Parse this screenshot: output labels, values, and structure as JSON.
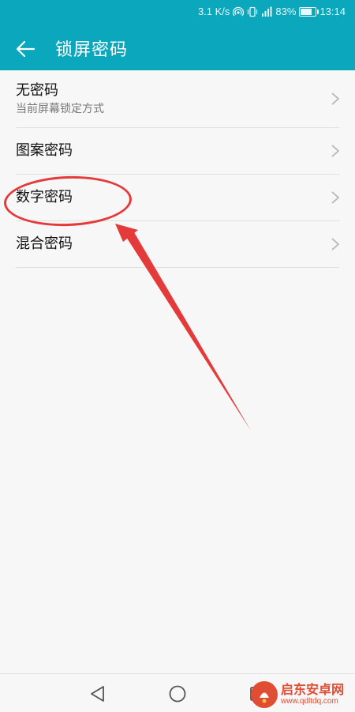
{
  "status_bar": {
    "speed": "3.1 K/s",
    "battery": "83%",
    "battery_level": 0.83,
    "time": "13:14",
    "icons": [
      "hotspot-icon",
      "vibrate-icon",
      "signal-4g-icon",
      "battery-icon"
    ]
  },
  "header": {
    "back_icon": "back-arrow-icon",
    "title": "锁屏密码",
    "background": "#0aa7bd"
  },
  "list": {
    "items": [
      {
        "title": "无密码",
        "subtitle": "当前屏幕锁定方式"
      },
      {
        "title": "图案密码"
      },
      {
        "title": "数字密码"
      },
      {
        "title": "混合密码"
      }
    ],
    "chevron_icon": "chevron-right-icon"
  },
  "annotation": {
    "color": "#e53a3a",
    "circled_item": "数字密码"
  },
  "nav_bar": {
    "buttons": [
      "back-triangle-icon",
      "home-circle-icon",
      "recents-square-icon"
    ]
  },
  "watermark": {
    "name": "启东安卓网",
    "url": "www.qdltdq.com"
  }
}
